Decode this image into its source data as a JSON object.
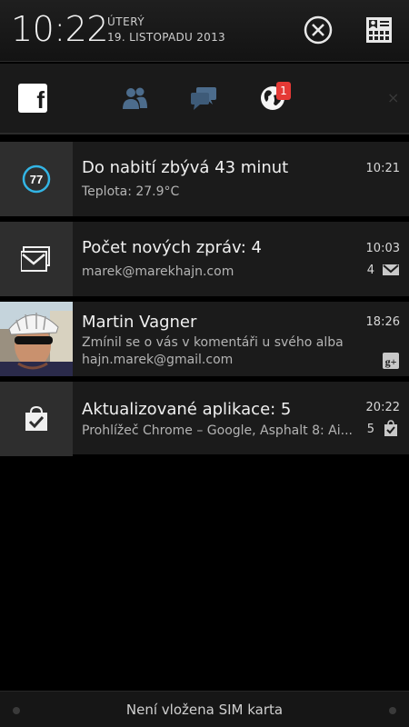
{
  "status": {
    "time": "10:22",
    "day": "ÚTERÝ",
    "date": "19. LISTOPADU 2013"
  },
  "social": {
    "facebook_letter": "f",
    "notification_badge": "1",
    "close_symbol": "×",
    "icons": [
      "facebook-icon",
      "people-icon",
      "chat-icon",
      "globe-icon"
    ]
  },
  "notifications": [
    {
      "title": "Do nabití zbývá 43 minut",
      "subtitle": "Teplota: 27.9°C",
      "time": "10:21",
      "battery_value": "77"
    },
    {
      "title": "Počet nových zpráv: 4",
      "subtitle": "marek@marekhajn.com",
      "time": "10:03",
      "count": "4"
    },
    {
      "title": "Martin Vagner",
      "line1": "Zmínil se o vás v komentáři u svého alba",
      "line2": "hajn.marek@gmail.com",
      "time": "18:26"
    },
    {
      "title": "Aktualizované aplikace: 5",
      "subtitle": "Prohlížeč Chrome – Google, Asphalt 8: Ai...",
      "time": "20:22",
      "count": "5"
    }
  ],
  "bottom": {
    "sim_text": "Není vložena SIM karta"
  },
  "colors": {
    "background": "#000000",
    "card": "#1b1b1b",
    "icon_box": "#2e2e2e",
    "badge": "#e53935",
    "battery_ring": "#33b5e5"
  }
}
